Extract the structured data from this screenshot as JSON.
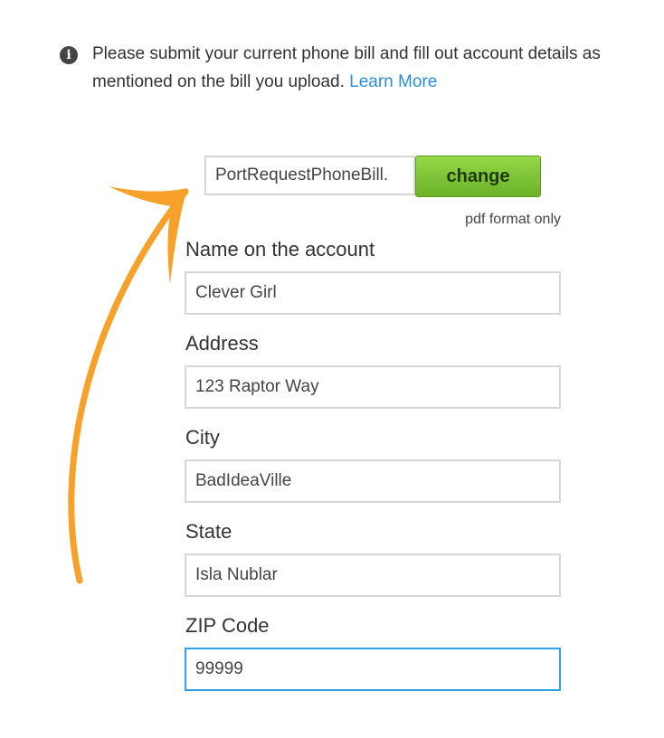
{
  "info": {
    "icon": "info-icon",
    "text": "Please submit your current phone bill and fill out account details as mentioned on the bill you upload.",
    "link": "Learn More"
  },
  "upload": {
    "filename": "PortRequestPhoneBill.",
    "change_label": "change",
    "note": "pdf format only"
  },
  "fields": {
    "name": {
      "label": "Name on the account",
      "value": "Clever Girl"
    },
    "address": {
      "label": "Address",
      "value": "123 Raptor Way"
    },
    "city": {
      "label": "City",
      "value": "BadIdeaVille"
    },
    "state": {
      "label": "State",
      "value": "Isla Nublar"
    },
    "zip": {
      "label": "ZIP Code",
      "value": "99999"
    }
  },
  "colors": {
    "arrow": "#f7a02a",
    "link": "#2a8ed8",
    "button": "#7cc233",
    "focus": "#2ea3e6"
  }
}
